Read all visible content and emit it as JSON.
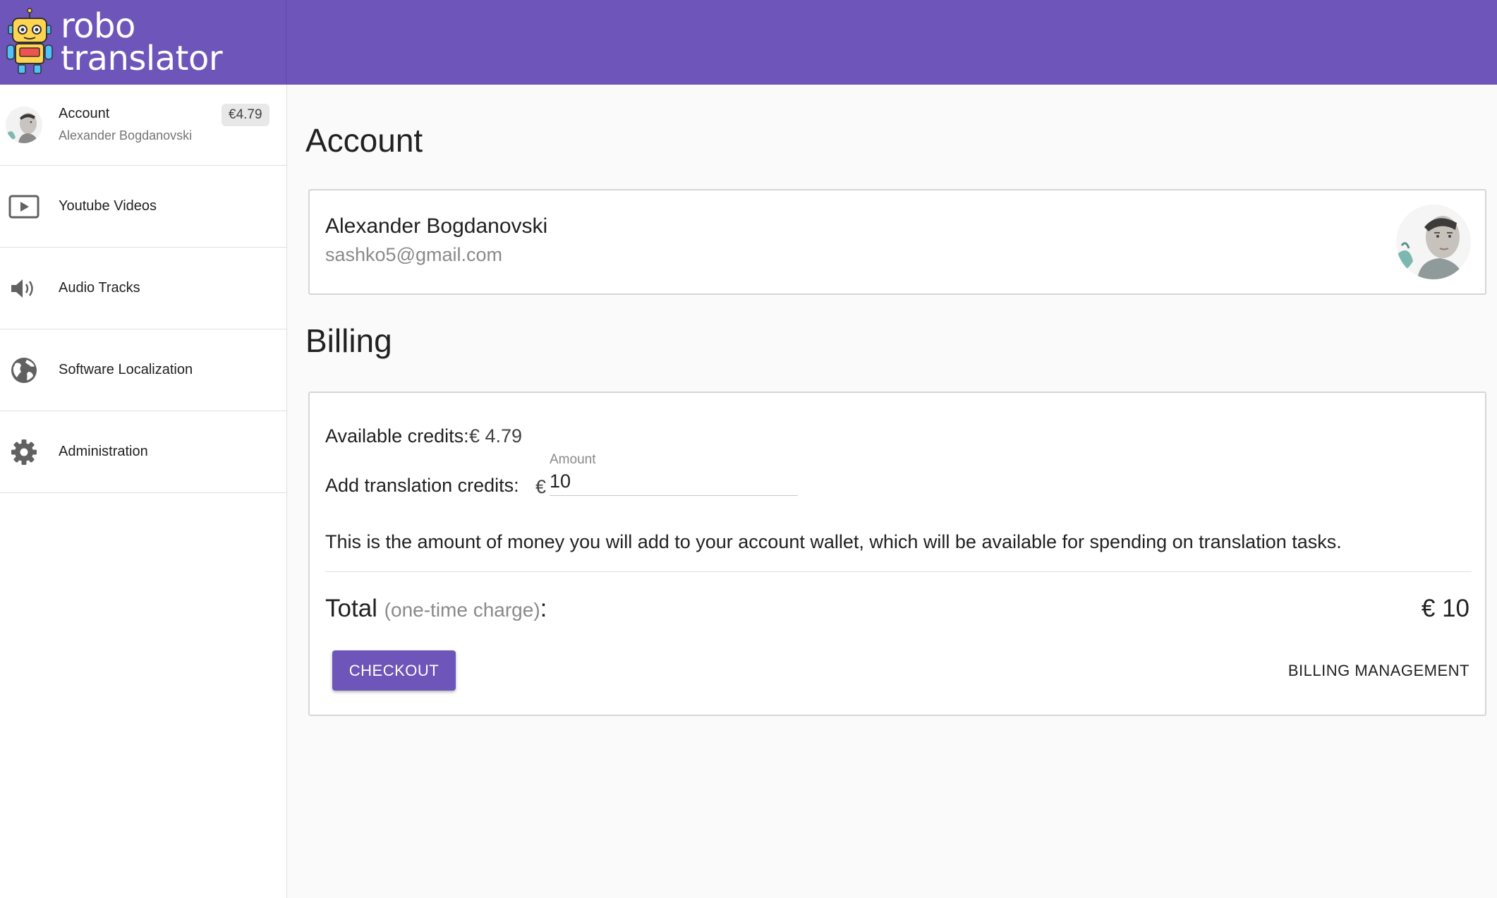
{
  "brand": {
    "line1": "robo",
    "line2": "translator",
    "color": "#6e55ba"
  },
  "sidebar": {
    "account": {
      "label": "Account",
      "user": "Alexander Bogdanovski",
      "balance": "€4.79"
    },
    "items": [
      {
        "label": "Youtube Videos",
        "icon": "play-icon"
      },
      {
        "label": "Audio Tracks",
        "icon": "volume-icon"
      },
      {
        "label": "Software Localization",
        "icon": "globe-icon"
      },
      {
        "label": "Administration",
        "icon": "gear-icon"
      }
    ]
  },
  "account": {
    "heading": "Account",
    "name": "Alexander Bogdanovski",
    "email": "sashko5@gmail.com"
  },
  "billing": {
    "heading": "Billing",
    "available_label": "Available credits:",
    "available_value": "€ 4.79",
    "add_label": "Add translation credits:",
    "currency_symbol": "€",
    "amount_label": "Amount",
    "amount_value": "10",
    "description": "This is the amount of money you will add to your account wallet, which will be available for spending on translation tasks.",
    "total_label": "Total",
    "total_note": "(one-time charge)",
    "total_colon": ":",
    "total_value": "€ 10",
    "checkout_label": "CHECKOUT",
    "billing_management_label": "BILLING MANAGEMENT"
  }
}
